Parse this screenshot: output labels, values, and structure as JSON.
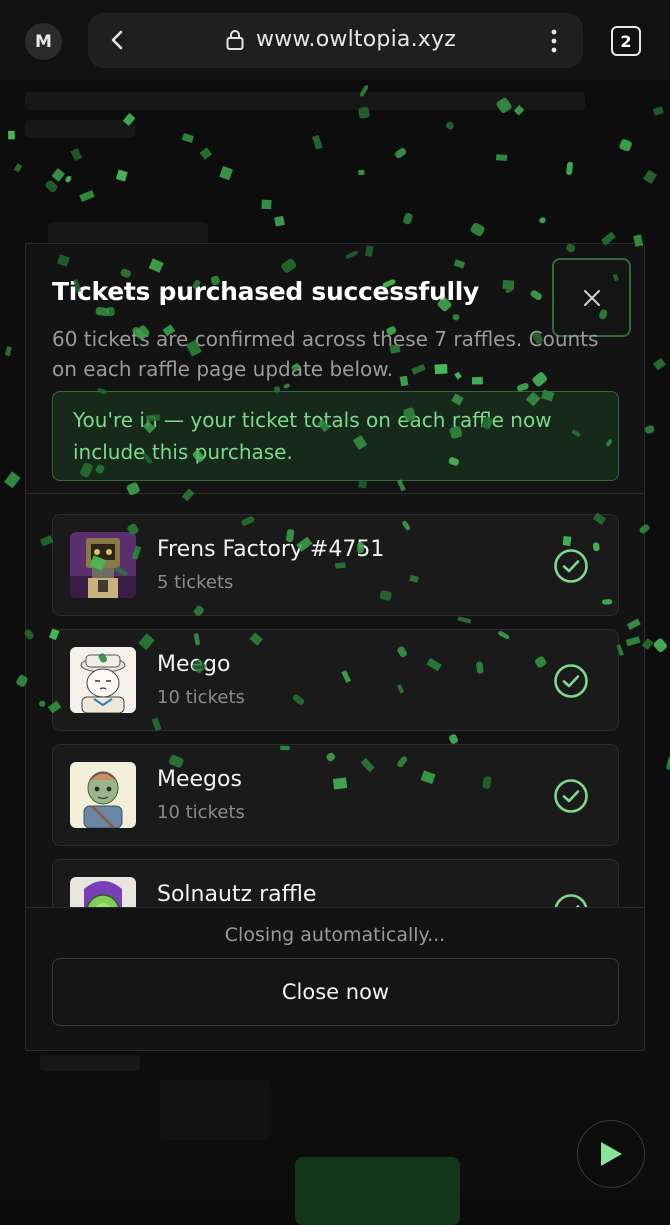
{
  "browser": {
    "profile_initial": "M",
    "url": "www.owltopia.xyz",
    "tab_count": "2",
    "icons": [
      "back-icon",
      "lock-icon",
      "more-icon",
      "tabs-icon"
    ]
  },
  "modal": {
    "title": "Tickets purchased successfully",
    "description": "60 tickets are confirmed across these 7 raffles. Counts on each raffle page update below.",
    "success_message": "You're in — your ticket totals on each raffle now include this purchase.",
    "raffles": [
      {
        "name": "Frens Factory #4751",
        "tickets": "5 tickets"
      },
      {
        "name": "Meego",
        "tickets": "10 tickets"
      },
      {
        "name": "Meegos",
        "tickets": "10 tickets"
      },
      {
        "name": "Solnautz raffle",
        "tickets": ""
      }
    ],
    "closing_text": "Closing automatically...",
    "close_now_label": "Close now"
  },
  "colors": {
    "accent_green": "#7ed98b",
    "success_border": "#2f6a38",
    "background": "#0b0b0b"
  }
}
